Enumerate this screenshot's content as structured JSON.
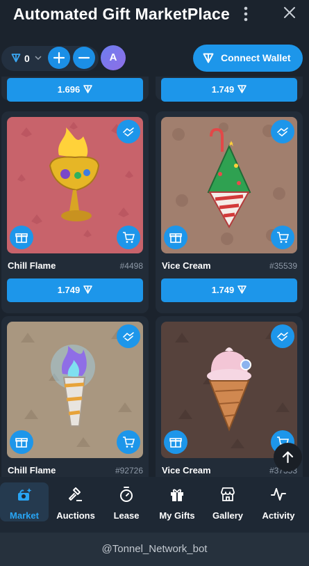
{
  "app": {
    "title": "Automated Gift MarketPlace"
  },
  "toolbar": {
    "balance": "0",
    "avatar_initial": "A",
    "connect_label": "Connect Wallet"
  },
  "partial_row": {
    "prices": [
      "1.696",
      "1.749"
    ]
  },
  "cards": [
    {
      "name": "Chill Flame",
      "number": "#4498",
      "price": "1.749",
      "art": "chill-flame-trophy"
    },
    {
      "name": "Vice Cream",
      "number": "#35539",
      "price": "1.749",
      "art": "vice-cream-tree"
    },
    {
      "name": "Chill Flame",
      "number": "#92726",
      "price": "",
      "art": "chill-flame-torch"
    },
    {
      "name": "Vice Cream",
      "number": "#37353",
      "price": "",
      "art": "vice-cream-cone"
    }
  ],
  "nav": {
    "items": [
      {
        "label": "Market",
        "icon": "market-icon",
        "active": true
      },
      {
        "label": "Auctions",
        "icon": "gavel-icon",
        "active": false
      },
      {
        "label": "Lease",
        "icon": "timer-icon",
        "active": false
      },
      {
        "label": "My Gifts",
        "icon": "gift-icon",
        "active": false
      },
      {
        "label": "Gallery",
        "icon": "store-icon",
        "active": false
      },
      {
        "label": "Activity",
        "icon": "activity-icon",
        "active": false
      }
    ]
  },
  "footer": {
    "bot_name": "@Tonnel_Network_bot"
  },
  "colors": {
    "background": "#1b232d",
    "accent": "#1d96ea",
    "active_nav": "#28a5f5"
  }
}
